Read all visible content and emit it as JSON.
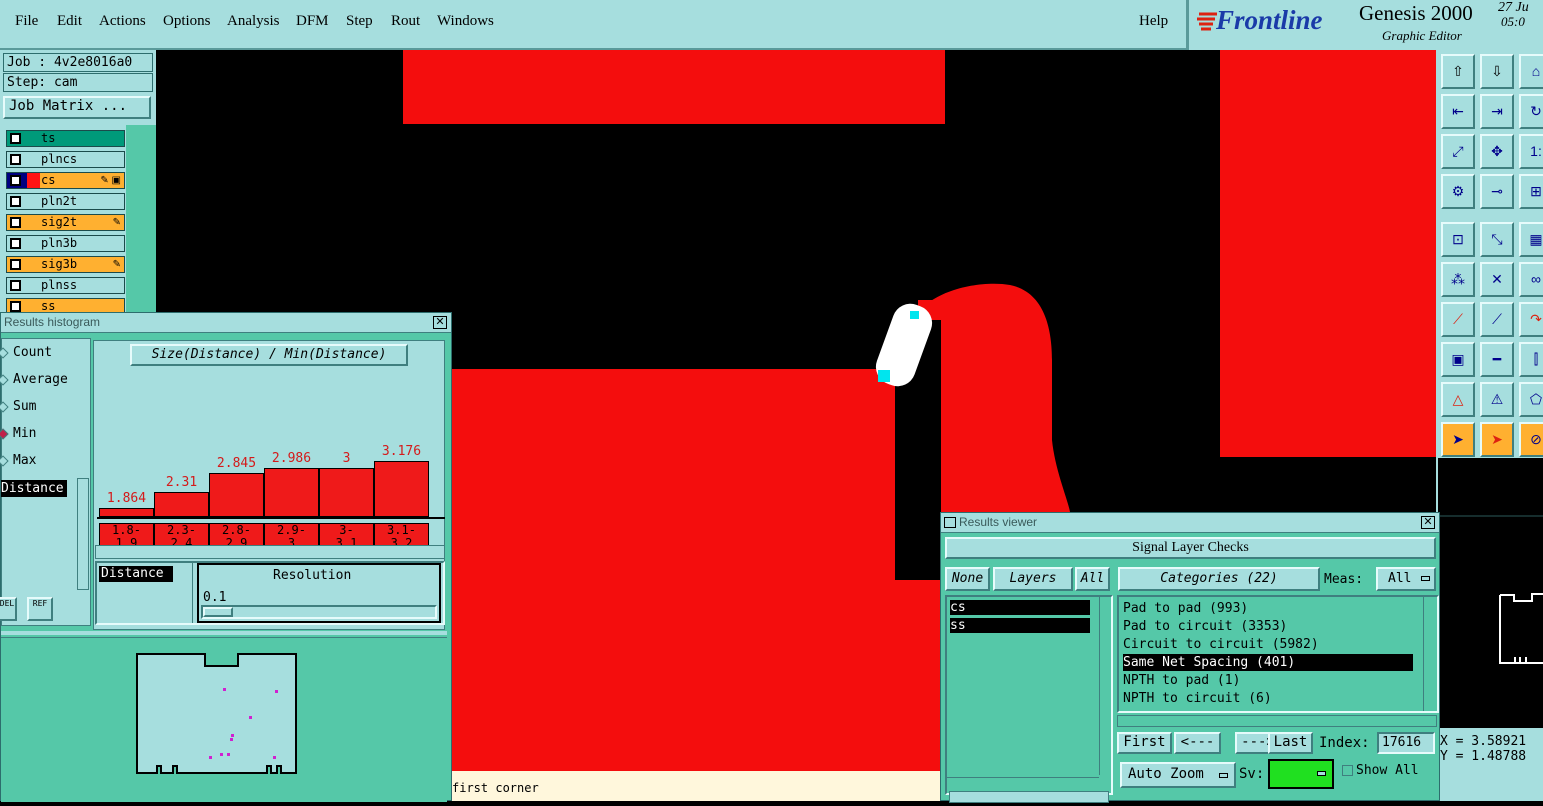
{
  "menus": [
    "File",
    "Edit",
    "Actions",
    "Options",
    "Analysis",
    "DFM",
    "Step",
    "Rout",
    "Windows"
  ],
  "help": "Help",
  "brand": {
    "logo": "Frontline",
    "product": "Genesis 2000",
    "subtitle": "Graphic Editor",
    "date1": "27 Ju",
    "date2": "05:0"
  },
  "job": {
    "job": "Job : 4v2e8016a0",
    "step": "Step: cam",
    "matrix_button": "Job Matrix ..."
  },
  "layers": [
    {
      "name": "ts",
      "color": "#009a7a",
      "box": "#fff"
    },
    {
      "name": "plncs",
      "color": "#a6dede",
      "box": "#fff"
    },
    {
      "name": "cs",
      "color": "#ffb030",
      "box": "#fff",
      "lead": "#000080",
      "swatch": "#ff1414",
      "extra": "✎ ▣"
    },
    {
      "name": "pln2t",
      "color": "#a6dede",
      "box": "#fff"
    },
    {
      "name": "sig2t",
      "color": "#ffb030",
      "box": "#fff",
      "extra": "✎"
    },
    {
      "name": "pln3b",
      "color": "#a6dede",
      "box": "#fff"
    },
    {
      "name": "sig3b",
      "color": "#ffb030",
      "box": "#fff",
      "extra": "✎"
    },
    {
      "name": "plnss",
      "color": "#a6dede",
      "box": "#fff"
    },
    {
      "name": "ss",
      "color": "#ffb030",
      "box": "#fff"
    }
  ],
  "histogram": {
    "title": "Results histogram",
    "close": "✕",
    "radios": [
      "Count",
      "Average",
      "Sum",
      "Min",
      "Max"
    ],
    "selected": "Min",
    "selected_attr": "Distance",
    "chart_title": "Size(Distance) / Min(Distance)",
    "bars": [
      {
        "value": "1.864",
        "range1": "1.8-",
        "range2": "1.9",
        "level": 1.864
      },
      {
        "value": "2.31",
        "range1": "2.3-",
        "range2": "2.4",
        "level": 2.31
      },
      {
        "value": "2.845",
        "range1": "2.8-",
        "range2": "2.9",
        "level": 2.845
      },
      {
        "value": "2.986",
        "range1": "2.9-",
        "range2": "3",
        "level": 2.986
      },
      {
        "value": "3",
        "range1": "3-",
        "range2": "3.1",
        "level": 3
      },
      {
        "value": "3.176",
        "range1": "3.1-",
        "range2": "3.2",
        "level": 3.176
      }
    ],
    "attr_field": "Distance",
    "resolution_label": "Resolution",
    "resolution_value": "0.1",
    "btn1": "DEL",
    "btn2": "REF"
  },
  "results": {
    "title": "Results viewer",
    "header": "Signal Layer Checks",
    "none": "None",
    "layers_btn": "Layers",
    "all": "All",
    "categories": "Categories (22)",
    "meas_label": "Meas:",
    "meas_value": "All",
    "layer_list": [
      "cs",
      "ss"
    ],
    "category_list": [
      "Pad to pad (993)",
      "Pad to circuit (3353)",
      "Circuit to circuit (5982)",
      "Same Net Spacing (401)",
      "NPTH to pad (1)",
      "NPTH to circuit (6)"
    ],
    "selected_category": "Same Net Spacing (401)",
    "first": "First",
    "prev": "<---",
    "next": "--->",
    "last": "Last",
    "index_label": "Index:",
    "index_value": "17616",
    "auto_zoom": "Auto Zoom",
    "sv_label": "Sv:",
    "show_all": "Show All"
  },
  "status_text": "first corner",
  "coords": {
    "x": "X = 3.58921",
    "y": "Y = 1.48788"
  },
  "tool_icons": [
    "up-icon",
    "down-icon",
    "home-icon",
    "left-icon",
    "right-icon",
    "redo-icon",
    "fit-icon",
    "zoom-icon",
    "scale-icon",
    "measure-icon",
    "probe-icon",
    "grid-icon",
    "snap-icon",
    "slope-icon",
    "ruler-icon",
    "net-icon",
    "cross-icon",
    "link-icon",
    "line-red-icon",
    "line-blue-icon",
    "arc-icon",
    "pad-icon",
    "dash-icon",
    "spacing-icon",
    "triangle-icon",
    "arrow-tri-icon",
    "shape-icon",
    "select-icon",
    "select-red-icon",
    "stop-icon"
  ]
}
